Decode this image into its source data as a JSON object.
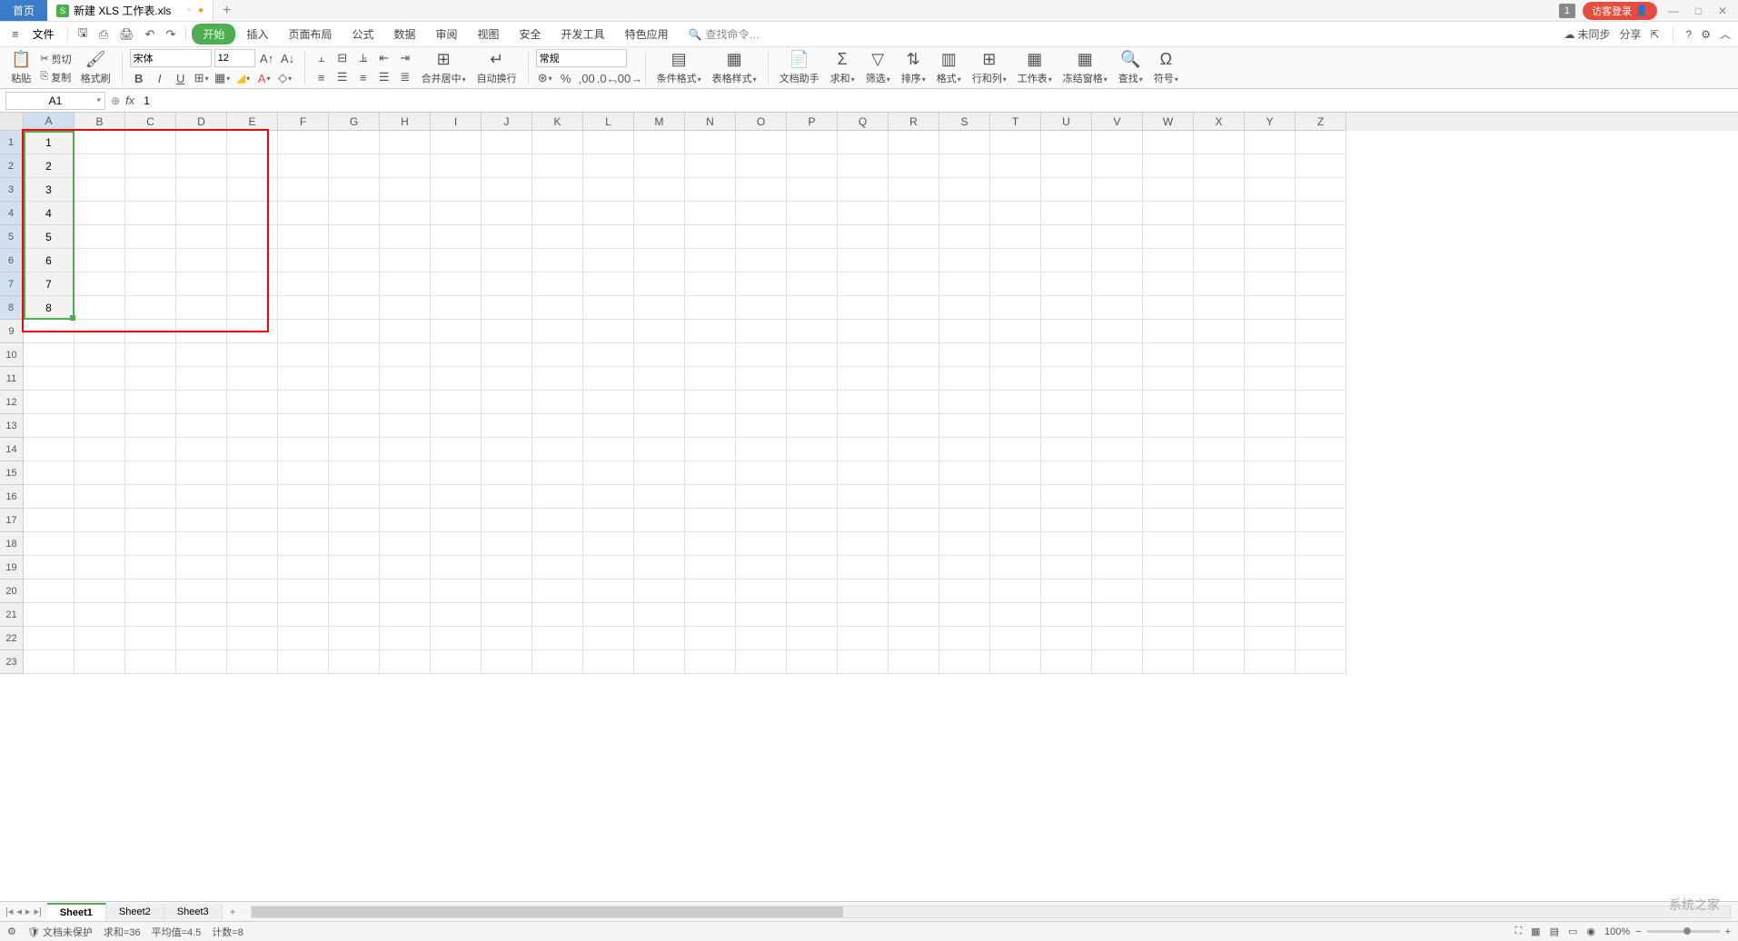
{
  "titleBar": {
    "homeTab": "首页",
    "fileTab": "新建 XLS 工作表.xls",
    "badgeNum": "1",
    "loginBtn": "访客登录"
  },
  "menuBar": {
    "fileMenu": "文件",
    "tabs": [
      "开始",
      "插入",
      "页面布局",
      "公式",
      "数据",
      "审阅",
      "视图",
      "安全",
      "开发工具",
      "特色应用"
    ],
    "searchPlaceholder": "查找命令…",
    "syncStatus": "未同步",
    "shareBtn": "分享"
  },
  "ribbon": {
    "paste": "粘贴",
    "cut": "剪切",
    "copy": "复制",
    "formatPainter": "格式刷",
    "fontName": "宋体",
    "fontSize": "12",
    "mergeCenter": "合并居中",
    "autoWrap": "自动换行",
    "numberFormat": "常规",
    "condFormat": "条件格式",
    "tableStyle": "表格样式",
    "docHelper": "文档助手",
    "sum": "求和",
    "filter": "筛选",
    "sort": "排序",
    "format": "格式",
    "rowsCols": "行和列",
    "worksheet": "工作表",
    "freezePanes": "冻结窗格",
    "find": "查找",
    "symbol": "符号"
  },
  "formulaBar": {
    "nameBox": "A1",
    "formulaValue": "1"
  },
  "grid": {
    "columns": [
      "A",
      "B",
      "C",
      "D",
      "E",
      "F",
      "G",
      "H",
      "I",
      "J",
      "K",
      "L",
      "M",
      "N",
      "O",
      "P",
      "Q",
      "R",
      "S",
      "T",
      "U",
      "V",
      "W",
      "X",
      "Y",
      "Z"
    ],
    "rowCount": 23,
    "selectedCol": "A",
    "selectedRowsStart": 1,
    "selectedRowsEnd": 8,
    "cellData": {
      "A1": "1",
      "A2": "2",
      "A3": "3",
      "A4": "4",
      "A5": "5",
      "A6": "6",
      "A7": "7",
      "A8": "8"
    }
  },
  "sheets": {
    "tabs": [
      "Sheet1",
      "Sheet2",
      "Sheet3"
    ],
    "active": "Sheet1"
  },
  "statusBar": {
    "docProtect": "文档未保护",
    "sum": "求和=36",
    "avg": "平均值=4.5",
    "count": "计数=8",
    "zoom": "100%"
  },
  "watermark": "系统之家"
}
